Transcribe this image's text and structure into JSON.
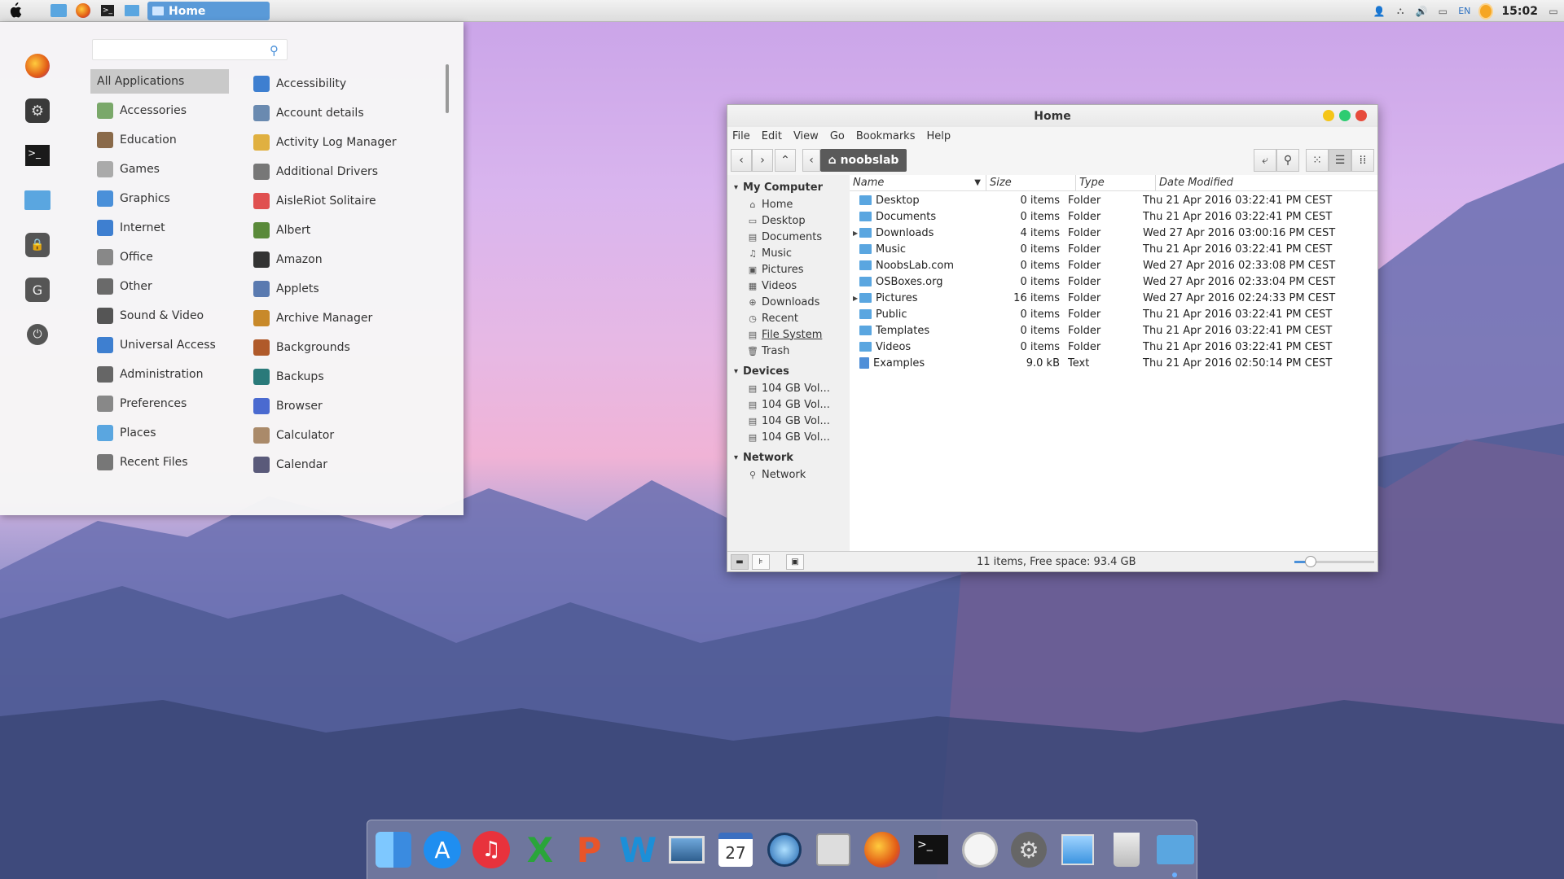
{
  "top_panel": {
    "active_window": "Home",
    "language": "EN",
    "clock": "15:02"
  },
  "app_menu": {
    "search_placeholder": "",
    "categories": [
      "All Applications",
      "Accessories",
      "Education",
      "Games",
      "Graphics",
      "Internet",
      "Office",
      "Other",
      "Sound & Video",
      "Universal Access",
      "Administration",
      "Preferences",
      "Places",
      "Recent Files"
    ],
    "apps": [
      "Accessibility",
      "Account details",
      "Activity Log Manager",
      "Additional Drivers",
      "AisleRiot Solitaire",
      "Albert",
      "Amazon",
      "Applets",
      "Archive Manager",
      "Backgrounds",
      "Backups",
      "Browser",
      "Calculator",
      "Calendar"
    ]
  },
  "file_manager": {
    "title": "Home",
    "menu": [
      "File",
      "Edit",
      "View",
      "Go",
      "Bookmarks",
      "Help"
    ],
    "path": "noobslab",
    "sidebar": {
      "my_computer": "My Computer",
      "my_computer_items": [
        "Home",
        "Desktop",
        "Documents",
        "Music",
        "Pictures",
        "Videos",
        "Downloads",
        "Recent",
        "File System",
        "Trash"
      ],
      "devices": "Devices",
      "device_items": [
        "104 GB Vol...",
        "104 GB Vol...",
        "104 GB Vol...",
        "104 GB Vol..."
      ],
      "network": "Network",
      "network_items": [
        "Network"
      ]
    },
    "columns": {
      "name": "Name",
      "size": "Size",
      "type": "Type",
      "date": "Date Modified"
    },
    "rows": [
      {
        "name": "Desktop",
        "size": "0 items",
        "type": "Folder",
        "date": "Thu 21 Apr 2016 03:22:41 PM CEST"
      },
      {
        "name": "Documents",
        "size": "0 items",
        "type": "Folder",
        "date": "Thu 21 Apr 2016 03:22:41 PM CEST"
      },
      {
        "name": "Downloads",
        "size": "4 items",
        "type": "Folder",
        "date": "Wed 27 Apr 2016 03:00:16 PM CEST"
      },
      {
        "name": "Music",
        "size": "0 items",
        "type": "Folder",
        "date": "Thu 21 Apr 2016 03:22:41 PM CEST"
      },
      {
        "name": "NoobsLab.com",
        "size": "0 items",
        "type": "Folder",
        "date": "Wed 27 Apr 2016 02:33:08 PM CEST"
      },
      {
        "name": "OSBoxes.org",
        "size": "0 items",
        "type": "Folder",
        "date": "Wed 27 Apr 2016 02:33:04 PM CEST"
      },
      {
        "name": "Pictures",
        "size": "16 items",
        "type": "Folder",
        "date": "Wed 27 Apr 2016 02:24:33 PM CEST"
      },
      {
        "name": "Public",
        "size": "0 items",
        "type": "Folder",
        "date": "Thu 21 Apr 2016 03:22:41 PM CEST"
      },
      {
        "name": "Templates",
        "size": "0 items",
        "type": "Folder",
        "date": "Thu 21 Apr 2016 03:22:41 PM CEST"
      },
      {
        "name": "Videos",
        "size": "0 items",
        "type": "Folder",
        "date": "Thu 21 Apr 2016 03:22:41 PM CEST"
      },
      {
        "name": "Examples",
        "size": "9.0 kB",
        "type": "Text",
        "date": "Thu 21 Apr 2016 02:50:14 PM CEST"
      }
    ],
    "status": "11 items, Free space: 93.4 GB",
    "zoom_level": 0.2
  },
  "dock": {
    "calendar_day": "27"
  },
  "colors": {
    "accent": "#5a9ad8",
    "folder": "#5aa6e0",
    "close": "#e74c3c",
    "maximize": "#2ecc71",
    "minimize": "#f5c518"
  }
}
